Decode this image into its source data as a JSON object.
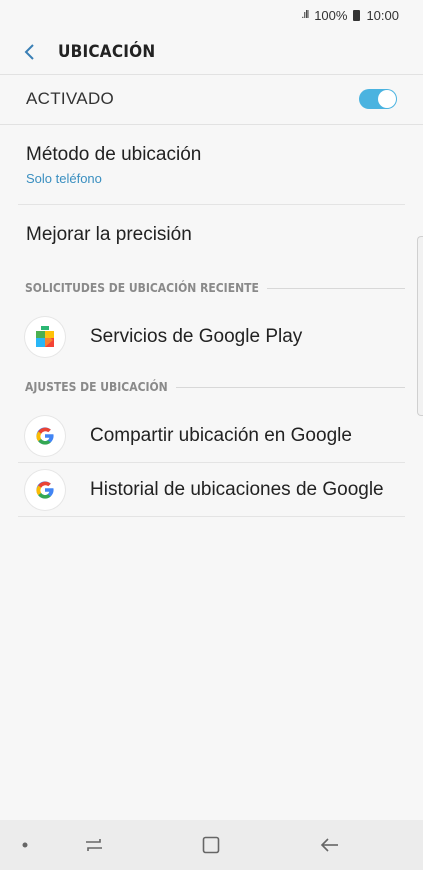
{
  "status_bar": {
    "battery": "100%",
    "time": "10:00"
  },
  "header": {
    "title": "UBICACIÓN",
    "back_icon": "chevron-left-icon"
  },
  "master": {
    "label": "ACTIVADO",
    "enabled": true,
    "accent": "#4ab3e0"
  },
  "settings": {
    "method": {
      "title": "Método de ubicación",
      "value": "Solo teléfono"
    },
    "accuracy": {
      "title": "Mejorar la precisión"
    }
  },
  "sections": {
    "recent": "SOLICITUDES DE UBICACIÓN RECIENTE",
    "settings": "AJUSTES DE UBICACIÓN"
  },
  "recent_apps": [
    {
      "label": "Servicios de Google Play",
      "icon": "google-play-services-icon"
    }
  ],
  "location_settings": [
    {
      "label": "Compartir ubicación en Google",
      "icon": "google-g-icon"
    },
    {
      "label": "Historial de ubicaciones de Google",
      "icon": "google-g-icon"
    }
  ],
  "nav": [
    "recent-apps-icon",
    "home-icon",
    "back-arrow-icon"
  ]
}
